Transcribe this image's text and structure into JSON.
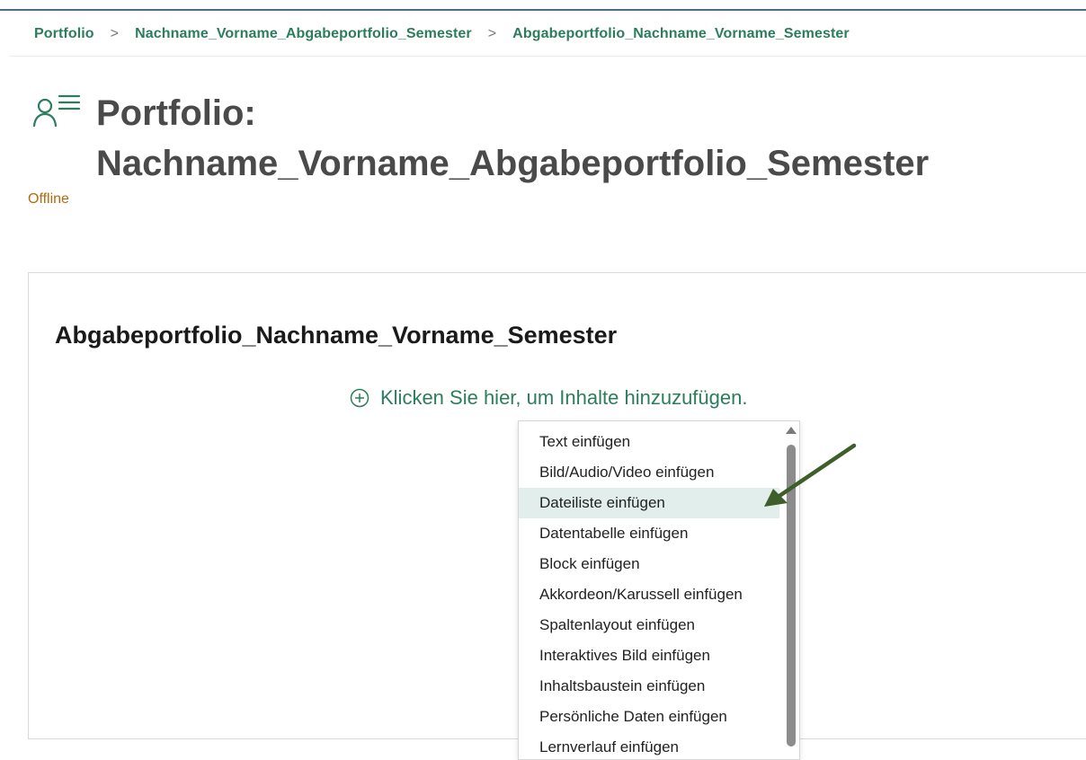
{
  "breadcrumb": {
    "items": [
      "Portfolio",
      "Nachname_Vorname_Abgabeportfolio_Semester",
      "Abgabeportfolio_Nachname_Vorname_Semester"
    ],
    "separator": ">"
  },
  "header": {
    "icon": "portfolio-user-list-icon",
    "title_line1": "Portfolio:",
    "title_line2": "Nachname_Vorname_Abgabeportfolio_Semester",
    "status": "Offline"
  },
  "content": {
    "page_heading": "Abgabeportfolio_Nachname_Vorname_Semester",
    "add_content_label": "Klicken Sie hier, um Inhalte hinzuzufügen.",
    "add_icon": "plus-circle-icon"
  },
  "menu": {
    "highlighted_index": 2,
    "items": [
      "Text einfügen",
      "Bild/Audio/Video einfügen",
      "Dateiliste einfügen",
      "Datentabelle einfügen",
      "Block einfügen",
      "Akkordeon/Karussell einfügen",
      "Spaltenlayout einfügen",
      "Interaktives Bild einfügen",
      "Inhaltsbaustein einfügen",
      "Persönliche Daten einfügen",
      "Lernverlauf einfügen"
    ]
  },
  "colors": {
    "accent_green": "#2c7d5e",
    "status_orange": "#b06a14",
    "highlight_bg": "#e2eeeb",
    "annotation_arrow": "#3e5f2a"
  }
}
